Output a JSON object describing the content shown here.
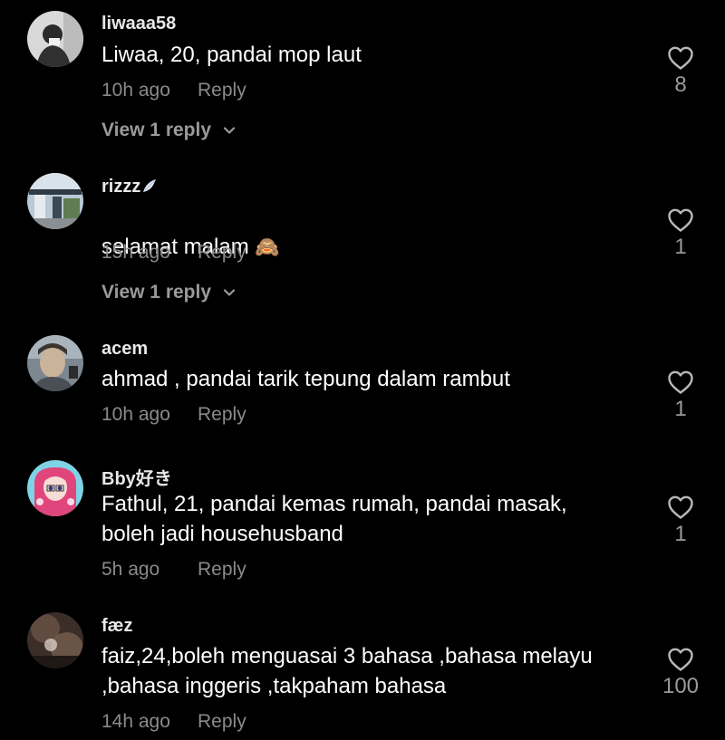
{
  "comments": [
    {
      "username": "liwaaa58",
      "text": "Liwaa, 20, pandai mop laut",
      "time": "10h ago",
      "reply_label": "Reply",
      "likes": "8",
      "view_replies": "View 1 reply"
    },
    {
      "username": "rizzz",
      "username_badge_icon": "angel-wing-icon",
      "text": "selamat malam",
      "text_emoji": "🙈",
      "time": "15h ago",
      "reply_label": "Reply",
      "likes": "1",
      "view_replies": "View 1 reply"
    },
    {
      "username": "acem",
      "text": "ahmad , pandai tarik tepung dalam rambut",
      "time": "10h ago",
      "reply_label": "Reply",
      "likes": "1"
    },
    {
      "username": "Bby好き",
      "text": "Fathul, 21, pandai kemas rumah, pandai masak,\nboleh jadi househusband",
      "time": "5h ago",
      "reply_label": "Reply",
      "likes": "1"
    },
    {
      "username": "fæz",
      "text": "faiz,24,boleh menguasai 3 bahasa ,bahasa melayu\n,bahasa inggeris ,takpaham bahasa",
      "time": "14h ago",
      "reply_label": "Reply",
      "likes": "100"
    }
  ],
  "colors": {
    "background": "#000000",
    "text_primary": "#ffffff",
    "text_secondary": "#8a8a8a",
    "heart_outline": "#b8b8b8"
  }
}
